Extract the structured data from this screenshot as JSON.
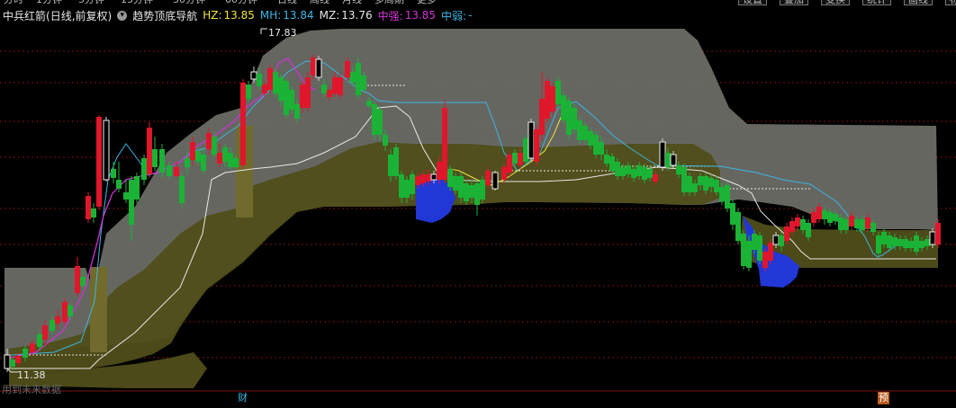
{
  "top_tabs": [
    "分时",
    "1分钟",
    "5分钟",
    "15分钟",
    "30分钟",
    "60分钟",
    "日线",
    "周线",
    "月线",
    "多周期",
    "更多"
  ],
  "top_buttons": [
    "设置",
    "叠加",
    "变换",
    "统计",
    "画线",
    "标记"
  ],
  "header": {
    "stock_name": "中兵红箭",
    "period": "(日线,前复权)",
    "indicator_name": "趋势顶底导航",
    "hz_label": "HZ:",
    "hz_value": "13.85",
    "mh_label": "MH:",
    "mh_value": "13.84",
    "mz_label": "MZ:",
    "mz_value": "13.76",
    "zq_label": "中强:",
    "zq_value": "13.85",
    "zr_label": "中弱:",
    "zr_value": "-"
  },
  "price_labels": {
    "high": "17.83",
    "low": "11.38"
  },
  "footer": {
    "no_data": "用到未来数据",
    "cai_marker": "财",
    "yu_marker": "预"
  },
  "colors": {
    "background": "#000000",
    "up_candle": "#e0162b",
    "down_candle": "#1bb336",
    "band_gray": "#6b6b66",
    "band_olive": "#4f4e19",
    "blue_zone": "#2137d6",
    "white_line": "#e8e8e8",
    "cyan_line": "#3ab6e6",
    "magenta_line": "#cc35d6",
    "yellow_line": "#e8e33a",
    "hz_color": "#f2e33a",
    "mh_color": "#3ab6e6",
    "mz_color": "#e8e8e8",
    "zq_color": "#d235d6",
    "zr_color": "#3ab6e6"
  }
}
